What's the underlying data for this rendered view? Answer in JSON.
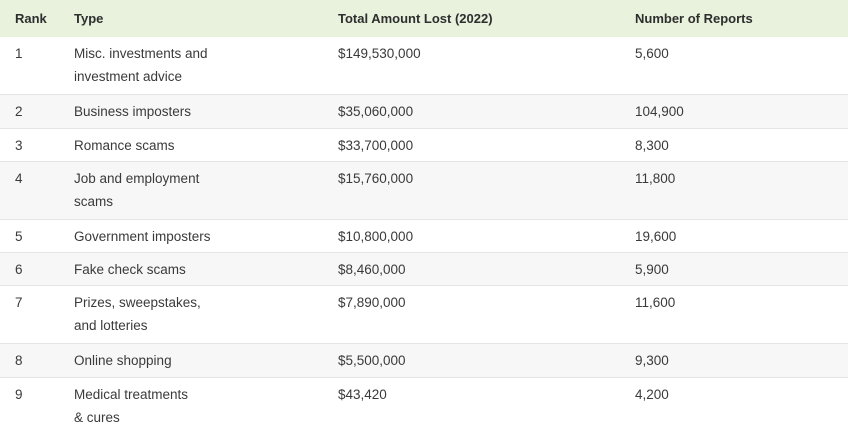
{
  "headers": {
    "rank": "Rank",
    "type": "Type",
    "amount": "Total Amount Lost (2022)",
    "reports": "Number of Reports"
  },
  "rows": [
    {
      "rank": "1",
      "type_line1": "Misc. investments and",
      "type_line2": "investment advice",
      "amount": "$149,530,000",
      "reports": "5,600"
    },
    {
      "rank": "2",
      "type_line1": "Business imposters",
      "type_line2": "",
      "amount": "$35,060,000",
      "reports": "104,900"
    },
    {
      "rank": "3",
      "type_line1": "Romance scams",
      "type_line2": "",
      "amount": "$33,700,000",
      "reports": "8,300"
    },
    {
      "rank": "4",
      "type_line1": "Job and employment",
      "type_line2": "scams",
      "amount": "$15,760,000",
      "reports": "11,800"
    },
    {
      "rank": "5",
      "type_line1": "Government imposters",
      "type_line2": "",
      "amount": "$10,800,000",
      "reports": "19,600"
    },
    {
      "rank": "6",
      "type_line1": "Fake check scams",
      "type_line2": "",
      "amount": "$8,460,000",
      "reports": "5,900"
    },
    {
      "rank": "7",
      "type_line1": "Prizes, sweepstakes,",
      "type_line2": "and lotteries",
      "amount": "$7,890,000",
      "reports": "11,600"
    },
    {
      "rank": "8",
      "type_line1": "Online shopping",
      "type_line2": "",
      "amount": "$5,500,000",
      "reports": "9,300"
    },
    {
      "rank": "9",
      "type_line1": "Medical treatments",
      "type_line2": "& cures",
      "amount": "$43,420",
      "reports": "4,200"
    }
  ]
}
